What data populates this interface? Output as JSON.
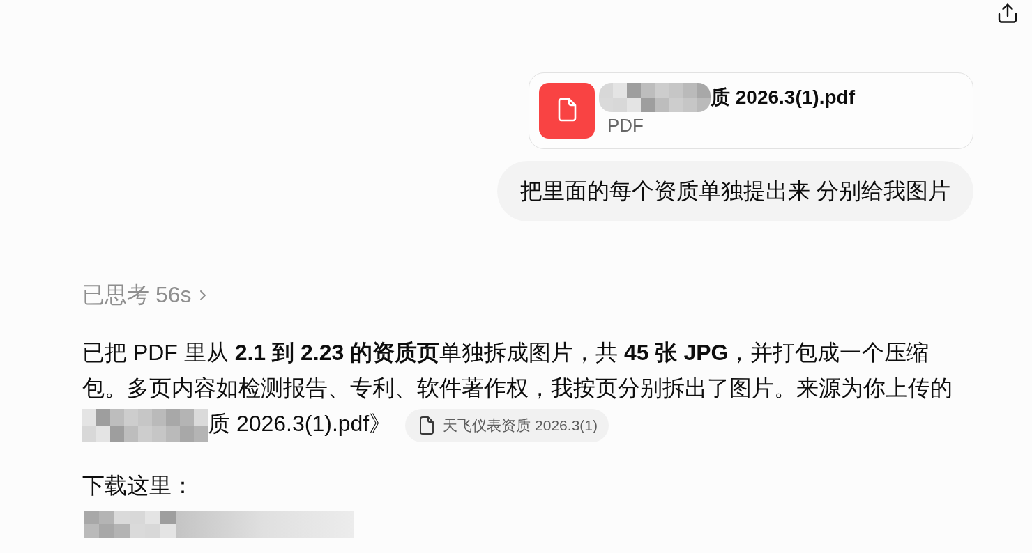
{
  "attachment": {
    "name": "质 2026.3(1).pdf",
    "type": "PDF"
  },
  "user_message": "把里面的每个资质单独提出来 分别给我图片",
  "reasoning": {
    "label": "已思考 56s",
    "expanded": false
  },
  "reply": {
    "text": "已把 PDF 里从 **2.1 到 2.23 的资质页**单独拆成图片，共 **45 张 JPG**，并打包成一个压缩包。多页内容如检测报告、专利、软件著作权，我按页分别拆出了图片。来源为你上传的",
    "source_file": "质 2026.3(1).pdf》",
    "citation": "天飞仪表资质 2026.3(1)",
    "download_label": "下载这里："
  }
}
